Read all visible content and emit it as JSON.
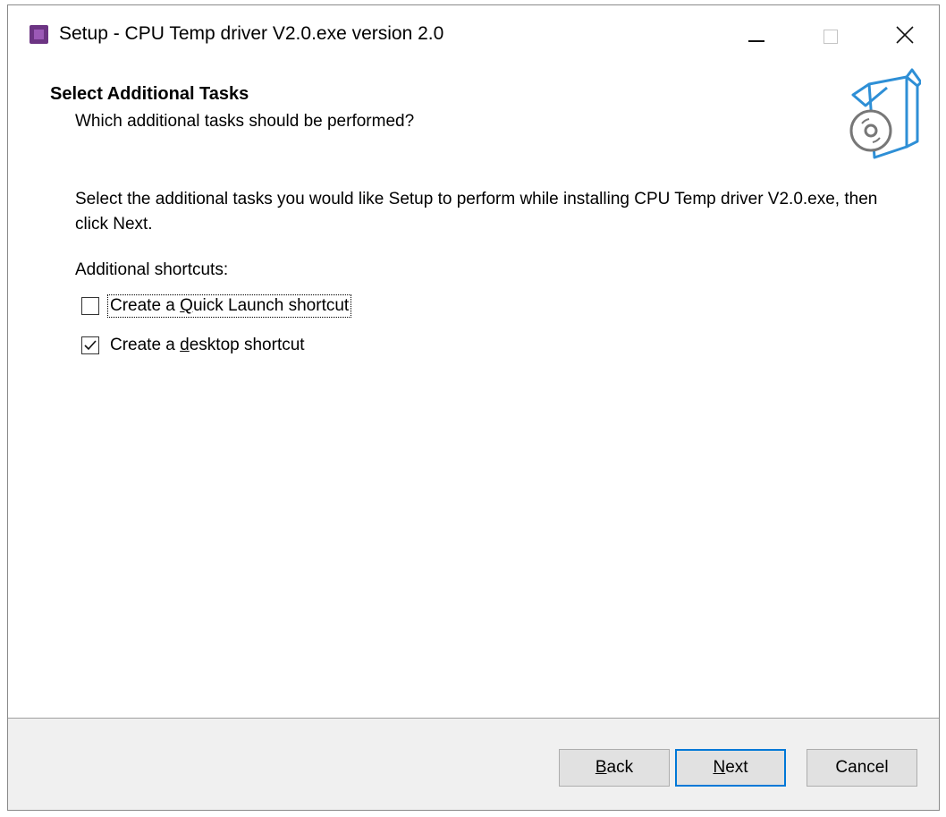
{
  "window": {
    "title": "Setup - CPU Temp driver V2.0.exe version 2.0",
    "icon": "cpu-chip-icon"
  },
  "header": {
    "title": "Select Additional Tasks",
    "subtitle": "Which additional tasks should be performed?",
    "icon": "software-box-cd-icon"
  },
  "body": {
    "description": "Select the additional tasks you would like Setup to perform while installing CPU Temp driver V2.0.exe, then click Next.",
    "group_label": "Additional shortcuts:",
    "tasks": [
      {
        "label_pre": "Create a ",
        "label_accel": "Q",
        "label_post": "uick Launch shortcut",
        "checked": false,
        "focused": true
      },
      {
        "label_pre": "Create a ",
        "label_accel": "d",
        "label_post": "esktop shortcut",
        "checked": true,
        "focused": false
      }
    ]
  },
  "buttons": {
    "back": {
      "accel": "B",
      "rest": "ack"
    },
    "next": {
      "accel": "N",
      "rest": "ext"
    },
    "cancel": "Cancel"
  },
  "colors": {
    "accent": "#0078d7",
    "footer_bg": "#f0f0f0",
    "button_bg": "#e1e1e1",
    "app_icon": "#6c3483"
  }
}
